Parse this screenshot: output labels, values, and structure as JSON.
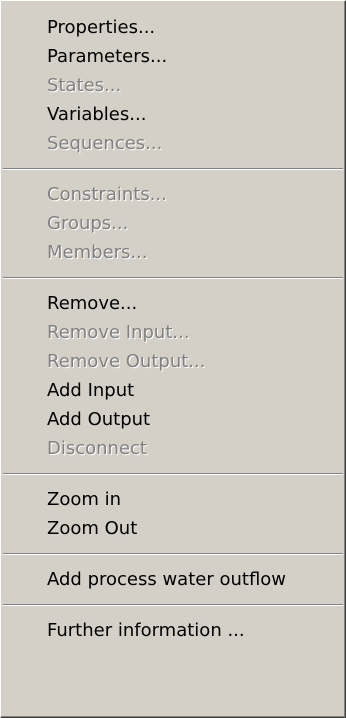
{
  "menu": {
    "items": [
      {
        "label": "Properties...",
        "enabled": true
      },
      {
        "label": "Parameters...",
        "enabled": true
      },
      {
        "label": "States...",
        "enabled": false
      },
      {
        "label": "Variables...",
        "enabled": true
      },
      {
        "label": "Sequences...",
        "enabled": false
      },
      {
        "label": "Constraints...",
        "enabled": false
      },
      {
        "label": "Groups...",
        "enabled": false
      },
      {
        "label": "Members...",
        "enabled": false
      },
      {
        "label": "Remove...",
        "enabled": true
      },
      {
        "label": "Remove Input...",
        "enabled": false
      },
      {
        "label": "Remove Output...",
        "enabled": false
      },
      {
        "label": "Add Input",
        "enabled": true
      },
      {
        "label": "Add Output",
        "enabled": true
      },
      {
        "label": "Disconnect",
        "enabled": false
      },
      {
        "label": "Zoom in",
        "enabled": true
      },
      {
        "label": "Zoom Out",
        "enabled": true
      },
      {
        "label": "Add process water outflow",
        "enabled": true
      },
      {
        "label": "Further information ...",
        "enabled": true
      }
    ]
  }
}
